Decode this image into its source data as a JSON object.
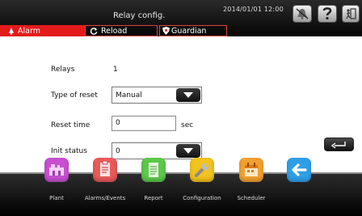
{
  "header": {
    "title": "Relay config.",
    "datetime": "2014/01/01  12:00",
    "tabs": {
      "alarm": "Alarm",
      "reload": "Reload",
      "guardian": "Guardian"
    }
  },
  "form": {
    "relays": {
      "label": "Relays",
      "value": "1"
    },
    "type_of_reset": {
      "label": "Type of reset",
      "selected": "Manual"
    },
    "reset_time": {
      "label": "Reset time",
      "value": "0",
      "unit": "sec"
    },
    "init_status": {
      "label": "Init status",
      "selected": "0"
    }
  },
  "nav": {
    "items": [
      {
        "label": "Plant",
        "icon": "plant-icon",
        "color": "#c84fd0"
      },
      {
        "label": "Alarms/Events",
        "icon": "alarms-events-icon",
        "color": "#e85a5a"
      },
      {
        "label": "Report",
        "icon": "report-icon",
        "color": "#5cc84a"
      },
      {
        "label": "Configuration",
        "icon": "wrench-icon",
        "color": "#f2c21e"
      },
      {
        "label": "Scheduler",
        "icon": "scheduler-icon",
        "color": "#f0a030"
      },
      {
        "label": "",
        "icon": "back-arrow-icon",
        "color": "#2f9fe8"
      }
    ]
  },
  "colors": {
    "alarm_tab": "#e31a1a",
    "tab_border": "#e04040",
    "header_bg": "#111111"
  }
}
